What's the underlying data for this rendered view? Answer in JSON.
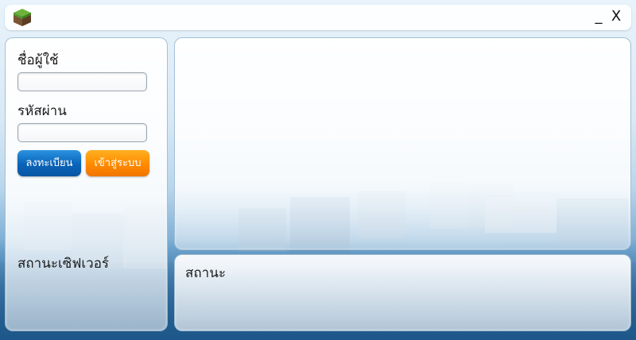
{
  "window": {
    "minimize_label": "_",
    "close_label": "X",
    "logo_icon": "grass-block-icon"
  },
  "login": {
    "username_label": "ชื่อผู้ใช้",
    "username_value": "",
    "password_label": "รหัสผ่าน",
    "password_value": "",
    "register_label": "ลงทะเบียน",
    "login_label": "เข้าสู่ระบบ",
    "server_status_label": "สถานะเซิฟเวอร์"
  },
  "status": {
    "label": "สถานะ"
  },
  "colors": {
    "register_button": "#0a63b8",
    "login_button": "#ff8a00"
  }
}
